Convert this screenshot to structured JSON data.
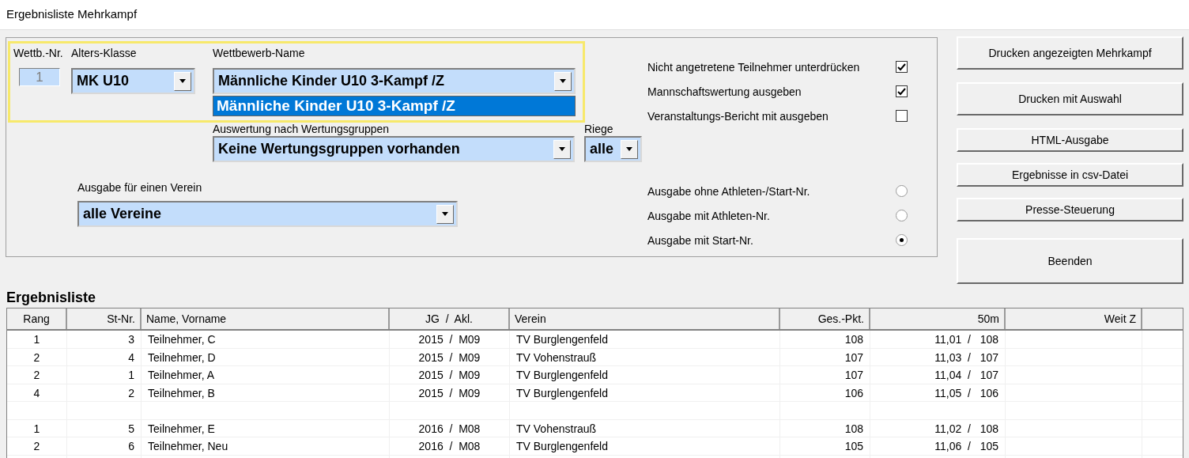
{
  "window": {
    "title": "Ergebnisliste Mehrkampf"
  },
  "competition_number": {
    "label": "Wettb.-Nr.",
    "value": "1",
    "disabled": true
  },
  "age_class": {
    "label": "Alters-Klasse",
    "value": "MK U10"
  },
  "competition_name": {
    "label": "Wettbewerb-Name",
    "value": "Männliche Kinder U10  3-Kampf /Z",
    "expanded": true,
    "options": [
      {
        "label": "Männliche Kinder U10  3-Kampf /Z",
        "selected": true
      }
    ]
  },
  "grouping": {
    "label": "Auswertung nach Wertungsgruppen",
    "value": "Keine Wertungsgruppen vorhanden"
  },
  "squad": {
    "label": "Riege",
    "value": "alle"
  },
  "club": {
    "label": "Ausgabe für einen Verein",
    "value": "alle Vereine"
  },
  "options": [
    {
      "label": "Nicht angetretene Teilnehmer unterdrücken",
      "checked": true
    },
    {
      "label": "Mannschaftswertung ausgeben",
      "checked": true
    },
    {
      "label": "Veranstaltungs-Bericht mit ausgeben",
      "checked": false
    }
  ],
  "number_mode": [
    {
      "label": "Ausgabe ohne Athleten-/Start-Nr.",
      "selected": false
    },
    {
      "label": "Ausgabe mit Athleten-Nr.",
      "selected": false
    },
    {
      "label": "Ausgabe mit Start-Nr.",
      "selected": true
    }
  ],
  "buttons": [
    {
      "label": "Drucken angezeigten Mehrkampf",
      "kind": "large"
    },
    {
      "label": "Drucken mit Auswahl",
      "kind": "large"
    },
    {
      "label": "HTML-Ausgabe",
      "kind": "small"
    },
    {
      "label": "Ergebnisse in csv-Datei",
      "kind": "small"
    },
    {
      "label": "Presse-Steuerung",
      "kind": "small"
    },
    {
      "label": "Beenden",
      "kind": "tall"
    }
  ],
  "results": {
    "title": "Ergebnisliste",
    "columns": [
      "Rang",
      "St-Nr.",
      "Name, Vorname",
      "JG  /  Akl.",
      "Verein",
      "Ges.-Pkt.",
      "50m",
      "Weit Z"
    ],
    "rows": [
      {
        "kind": "result",
        "cells": [
          "1",
          "3",
          "Teilnehmer, C",
          "2015  /  M09",
          "TV Burglengenfeld",
          "108",
          "11,01  /   108"
        ]
      },
      {
        "kind": "result",
        "cells": [
          "2",
          "4",
          "Teilnehmer, D",
          "2015  /  M09",
          "TV Vohenstrauß",
          "107",
          "11,03  /   107"
        ]
      },
      {
        "kind": "result",
        "cells": [
          "2",
          "1",
          "Teilnehmer, A",
          "2015  /  M09",
          "TV Burglengenfeld",
          "107",
          "11,04  /   107"
        ]
      },
      {
        "kind": "result",
        "cells": [
          "4",
          "2",
          "Teilnehmer, B",
          "2015  /  M09",
          "TV Burglengenfeld",
          "106",
          "11,05  /   106"
        ]
      },
      {
        "kind": "spacer",
        "cells": []
      },
      {
        "kind": "result",
        "cells": [
          "1",
          "5",
          "Teilnehmer, E",
          "2016  /  M08",
          "TV Vohenstrauß",
          "108",
          "11,02  /   108"
        ]
      },
      {
        "kind": "result",
        "cells": [
          "2",
          "6",
          "Teilnehmer, Neu",
          "2016  /  M08",
          "TV Burglengenfeld",
          "105",
          "11,06  /   105"
        ]
      }
    ]
  }
}
